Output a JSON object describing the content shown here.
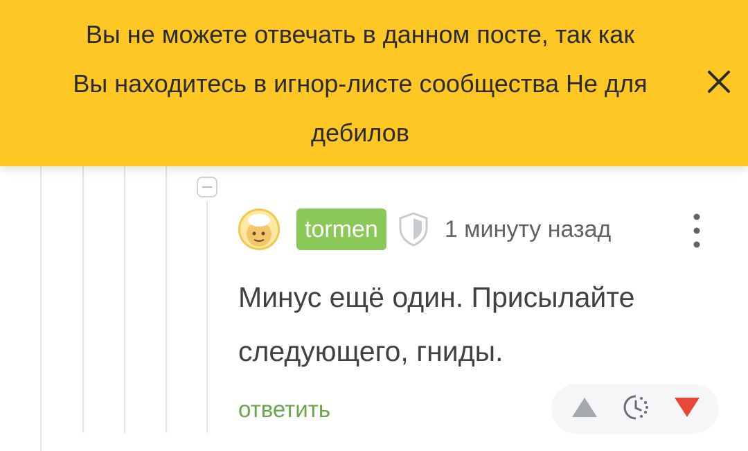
{
  "notice": {
    "lines": [
      "Вы не можете отвечать в данном посте, так как",
      "Вы находитесь в игнор-листе сообщества Не для",
      "дебилов"
    ],
    "close_icon": "close-icon",
    "background_color": "#fec724"
  },
  "comment": {
    "avatar_icon": "avatar",
    "username": "tormen",
    "username_bg": "#8ac858",
    "badge_icon": "shield-icon",
    "time": "1 минуту назад",
    "menu_icon": "more-vertical-icon",
    "body": "Минус ещё один. Присылайте следующего, гниды.",
    "reply_label": "ответить",
    "reply_color": "#68a64a",
    "collapse_icon": "minus-icon",
    "votes": {
      "upvote_icon": "upvote-triangle-icon",
      "timer_icon": "pending-rating-icon",
      "downvote_icon": "downvote-triangle-icon",
      "downvote_color": "#e8483a",
      "upvote_color": "#a5a9ae"
    }
  }
}
